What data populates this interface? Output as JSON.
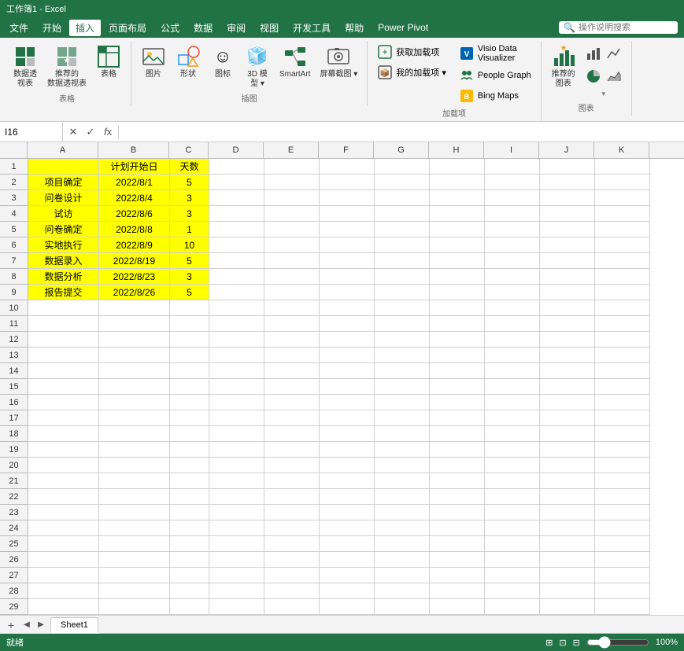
{
  "titleBar": {
    "text": "工作簿1 - Excel"
  },
  "menuBar": {
    "items": [
      "文件",
      "开始",
      "插入",
      "页面布局",
      "公式",
      "数据",
      "审阅",
      "视图",
      "开发工具",
      "帮助",
      "Power Pivot"
    ],
    "activeIndex": 2,
    "searchPlaceholder": "操作说明搜索"
  },
  "ribbon": {
    "groups": [
      {
        "label": "表格",
        "items": [
          {
            "id": "data-view",
            "icon": "🗃",
            "label": "数据透\n视表"
          },
          {
            "id": "data-view2",
            "icon": "📊",
            "label": "推荐的\n数据透视表"
          },
          {
            "id": "table",
            "icon": "⊞",
            "label": "表格"
          }
        ]
      },
      {
        "label": "插图",
        "items": [
          {
            "id": "image",
            "icon": "🖼",
            "label": "图片"
          },
          {
            "id": "shape",
            "icon": "⬡",
            "label": "形状"
          },
          {
            "id": "icon",
            "icon": "☺",
            "label": "图标"
          },
          {
            "id": "3d",
            "icon": "🧊",
            "label": "3D 模\n型"
          },
          {
            "id": "smartart",
            "icon": "🔷",
            "label": "SmartArt"
          },
          {
            "id": "screenshot",
            "icon": "📷",
            "label": "屏幕截图"
          }
        ]
      },
      {
        "label": "加载项",
        "items": [
          {
            "id": "get-addon",
            "icon": "🔌",
            "label": "获取加载项"
          },
          {
            "id": "my-addon",
            "icon": "📦",
            "label": "我的加载项"
          },
          {
            "id": "visio",
            "icon": "🔷",
            "label": "Visio Data\nVisualizer"
          },
          {
            "id": "people-graph",
            "icon": "👥",
            "label": "People Graph"
          },
          {
            "id": "bing-maps",
            "icon": "🗺",
            "label": "Bing Maps"
          }
        ]
      },
      {
        "label": "图表",
        "items": [
          {
            "id": "recommend-chart",
            "icon": "📈",
            "label": "推荐的\n图表"
          },
          {
            "id": "charts",
            "icon": "📊",
            "label": ""
          }
        ]
      }
    ]
  },
  "formulaBar": {
    "cellRef": "I16",
    "formula": ""
  },
  "columns": [
    "A",
    "B",
    "C",
    "D",
    "E",
    "F",
    "G",
    "H",
    "I",
    "J",
    "K"
  ],
  "rows": 29,
  "data": {
    "headers": {
      "B1": "计划开始日",
      "C1": "天数"
    },
    "cells": {
      "A2": "项目确定",
      "B2": "2022/8/1",
      "C2": "5",
      "A3": "问卷设计",
      "B3": "2022/8/4",
      "C3": "3",
      "A4": "试访",
      "B4": "2022/8/6",
      "C4": "3",
      "A5": "问卷确定",
      "B5": "2022/8/8",
      "C5": "1",
      "A6": "实地执行",
      "B6": "2022/8/9",
      "C6": "10",
      "A7": "数据录入",
      "B7": "2022/8/19",
      "C7": "5",
      "A8": "数据分析",
      "B8": "2022/8/23",
      "C8": "3",
      "A9": "报告提交",
      "B9": "2022/8/26",
      "C9": "5"
    }
  },
  "sheetTabs": {
    "active": "Sheet1",
    "tabs": [
      "Sheet1"
    ]
  },
  "statusBar": {
    "left": "就绪",
    "right": "⊞ ⊟ — 100%"
  }
}
